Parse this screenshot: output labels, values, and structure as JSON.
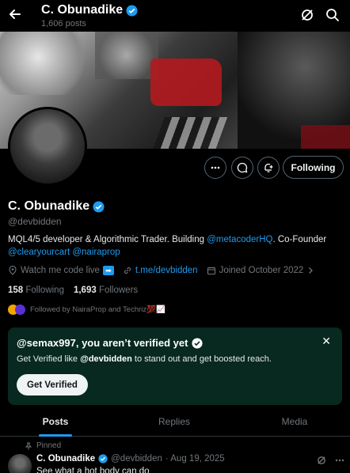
{
  "header": {
    "back_icon": "arrow-left-icon",
    "name": "C. Obunadike",
    "posts_count": "1,606 posts",
    "grok_icon": "grok-icon",
    "search_icon": "search-icon"
  },
  "profile": {
    "name": "C. Obunadike",
    "handle": "@devbidden",
    "bio": {
      "part1": "MQL4/5 developer & Algorithmic Trader. Building ",
      "link1": "@metacoderHQ",
      "part2": ". Co-Founder",
      "link2": "@clearyourcart",
      "link3": "@nairaprop"
    },
    "location": "Watch me code live",
    "website": "t.me/devbidden",
    "joined": "Joined October 2022",
    "following_count": "158",
    "following_label": "Following",
    "followers_count": "1,693",
    "followers_label": "Followers",
    "followed_by": "Followed by NairaProp and Techriz💯📈"
  },
  "actions": {
    "more_icon": "more-icon",
    "message_icon": "message-icon",
    "notify_icon": "bell-plus-icon",
    "follow_label": "Following"
  },
  "verify_card": {
    "title": "@semax997, you aren’t verified yet",
    "text_part1": "Get Verified like ",
    "text_handle": "@devbidden",
    "text_part2": " to stand out and get boosted reach.",
    "button_label": "Get Verified",
    "close_icon": "close-icon"
  },
  "tabs": [
    {
      "label": "Posts",
      "active": true
    },
    {
      "label": "Replies",
      "active": false
    },
    {
      "label": "Media",
      "active": false
    }
  ],
  "pinned_post": {
    "pinned_label": "Pinned",
    "author": "C. Obunadike",
    "handle": "@devbidden",
    "date": "· Aug 19, 2025",
    "text": "See what a hot body can do"
  },
  "colors": {
    "accent": "#1d9bf0",
    "background": "#000000",
    "verify_card_bg": "#07291f",
    "muted": "#71767b"
  }
}
